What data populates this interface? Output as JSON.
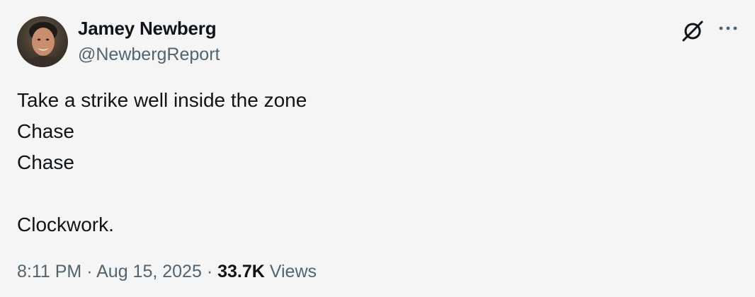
{
  "author": {
    "name": "Jamey Newberg",
    "handle": "@NewbergReport"
  },
  "icons": {
    "grok": "grok-icon",
    "more": "more-options-icon"
  },
  "tweet": {
    "lines": [
      "Take a strike well inside the zone",
      "Chase",
      "Chase",
      "",
      "Clockwork."
    ]
  },
  "meta": {
    "time": "8:11 PM",
    "separator": "·",
    "date": "Aug 15, 2025",
    "views_count": "33.7K",
    "views_label": "Views"
  },
  "colors": {
    "background": "#f5f5f5",
    "text": "#0f1419",
    "secondary_text": "#536471"
  }
}
